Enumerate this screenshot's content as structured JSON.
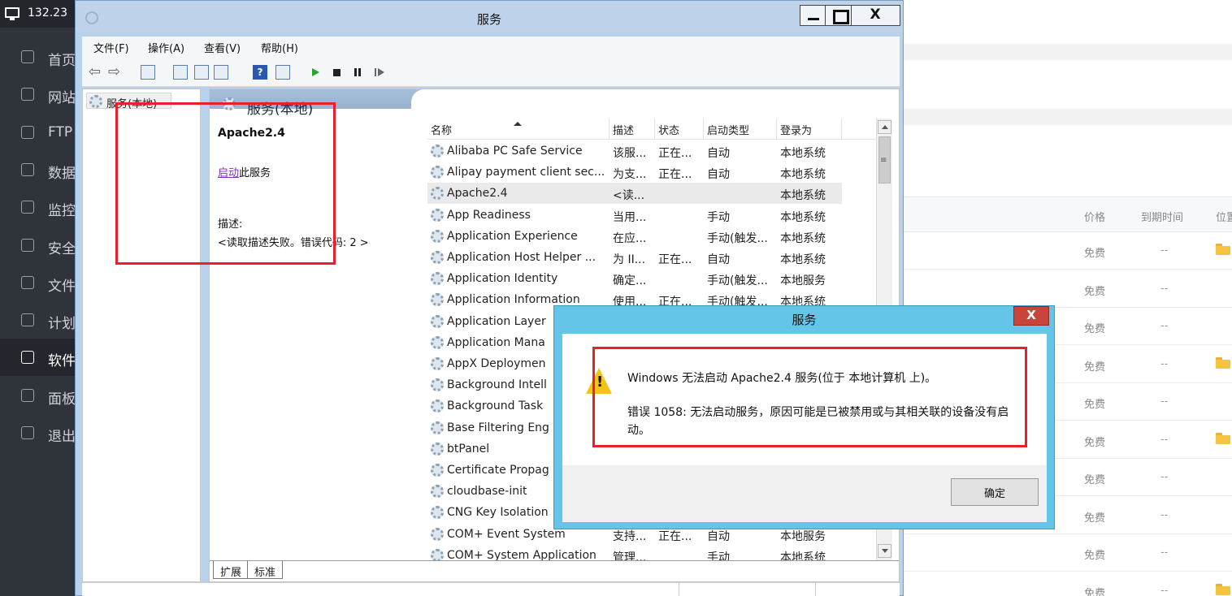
{
  "bg_panel": {
    "columns": {
      "price": "价格",
      "expire": "到期时间",
      "position": "位置"
    },
    "rows": [
      {
        "price": "免费",
        "expire": "--",
        "folder": true
      },
      {
        "price": "免费",
        "expire": "--",
        "folder": false
      },
      {
        "price": "免费",
        "expire": "--",
        "folder": false
      },
      {
        "price": "免费",
        "expire": "--",
        "folder": true
      },
      {
        "price": "免费",
        "expire": "--",
        "folder": false
      },
      {
        "price": "免费",
        "expire": "--",
        "folder": true
      },
      {
        "price": "免费",
        "expire": "--",
        "folder": false
      },
      {
        "price": "免费",
        "expire": "--",
        "folder": false
      },
      {
        "price": "免费",
        "expire": "--",
        "folder": false
      },
      {
        "price": "免费",
        "expire": "--",
        "folder": true
      }
    ]
  },
  "nav": {
    "server_ip": "132.23",
    "items": [
      {
        "label": "首页",
        "icon": "home-icon"
      },
      {
        "label": "网站",
        "icon": "globe-icon"
      },
      {
        "label": "FTP",
        "icon": "ftp-icon"
      },
      {
        "label": "数据",
        "icon": "database-icon"
      },
      {
        "label": "监控",
        "icon": "monitor-icon"
      },
      {
        "label": "安全",
        "icon": "shield-icon"
      },
      {
        "label": "文件",
        "icon": "folder-icon"
      },
      {
        "label": "计划",
        "icon": "calendar-icon"
      },
      {
        "label": "软件",
        "icon": "apps-icon",
        "active": true
      },
      {
        "label": "面板",
        "icon": "gear-icon"
      },
      {
        "label": "退出",
        "icon": "logout-icon"
      }
    ]
  },
  "services_window": {
    "title": "服务",
    "menu": [
      "文件(F)",
      "操作(A)",
      "查看(V)",
      "帮助(H)"
    ],
    "tree_root": "服务(本地)",
    "pane_header": "服务(本地)",
    "detail": {
      "service_name": "Apache2.4",
      "action_link": "启动",
      "action_suffix": "此服务",
      "desc_label": "描述:",
      "desc_text": "<读取描述失败。错误代码: 2 >"
    },
    "columns": [
      "名称",
      "描述",
      "状态",
      "启动类型",
      "登录为"
    ],
    "services": [
      {
        "name": "Alibaba PC Safe Service",
        "desc": "该服...",
        "status": "正在...",
        "startup": "自动",
        "logon": "本地系统"
      },
      {
        "name": "Alipay payment client sec...",
        "desc": "为支...",
        "status": "正在...",
        "startup": "自动",
        "logon": "本地系统"
      },
      {
        "name": "Apache2.4",
        "desc": "<读...",
        "status": "",
        "startup": "",
        "logon": "本地系统",
        "selected": true
      },
      {
        "name": "App Readiness",
        "desc": "当用...",
        "status": "",
        "startup": "手动",
        "logon": "本地系统"
      },
      {
        "name": "Application Experience",
        "desc": "在应...",
        "status": "",
        "startup": "手动(触发...",
        "logon": "本地系统"
      },
      {
        "name": "Application Host Helper ...",
        "desc": "为 II...",
        "status": "正在...",
        "startup": "自动",
        "logon": "本地系统"
      },
      {
        "name": "Application Identity",
        "desc": "确定...",
        "status": "",
        "startup": "手动(触发...",
        "logon": "本地服务"
      },
      {
        "name": "Application Information",
        "desc": "使用...",
        "status": "正在...",
        "startup": "手动(触发...",
        "logon": "本地系统"
      },
      {
        "name": "Application Layer",
        "desc": "",
        "status": "",
        "startup": "",
        "logon": ""
      },
      {
        "name": "Application Mana",
        "desc": "",
        "status": "",
        "startup": "",
        "logon": ""
      },
      {
        "name": "AppX Deploymen",
        "desc": "",
        "status": "",
        "startup": "",
        "logon": ""
      },
      {
        "name": "Background Intell",
        "desc": "",
        "status": "",
        "startup": "",
        "logon": ""
      },
      {
        "name": "Background Task",
        "desc": "",
        "status": "",
        "startup": "",
        "logon": ""
      },
      {
        "name": "Base Filtering Eng",
        "desc": "",
        "status": "",
        "startup": "",
        "logon": ""
      },
      {
        "name": "btPanel",
        "desc": "",
        "status": "",
        "startup": "",
        "logon": ""
      },
      {
        "name": "Certificate Propag",
        "desc": "",
        "status": "",
        "startup": "",
        "logon": ""
      },
      {
        "name": "cloudbase-init",
        "desc": "",
        "status": "",
        "startup": "",
        "logon": ""
      },
      {
        "name": "CNG Key Isolation",
        "desc": "",
        "status": "",
        "startup": "",
        "logon": ""
      },
      {
        "name": "COM+ Event System",
        "desc": "支持...",
        "status": "正在...",
        "startup": "自动",
        "logon": "本地服务"
      },
      {
        "name": "COM+ System Application",
        "desc": "管理...",
        "status": "",
        "startup": "手动",
        "logon": "本地系统"
      }
    ],
    "bottom_tabs": [
      "扩展",
      "标准"
    ]
  },
  "error_dialog": {
    "title": "服务",
    "message": "Windows 无法启动 Apache2.4 服务(位于 本地计算机 上)。",
    "error_detail": "错误 1058: 无法启动服务，原因可能是已被禁用或与其相关联的设备没有启动。",
    "ok_label": "确定"
  },
  "colors": {
    "highlight": "#e8202a",
    "dialog_frame": "#65c5e9",
    "nav_bg": "#2f343b",
    "link": "#7b2fbe"
  }
}
